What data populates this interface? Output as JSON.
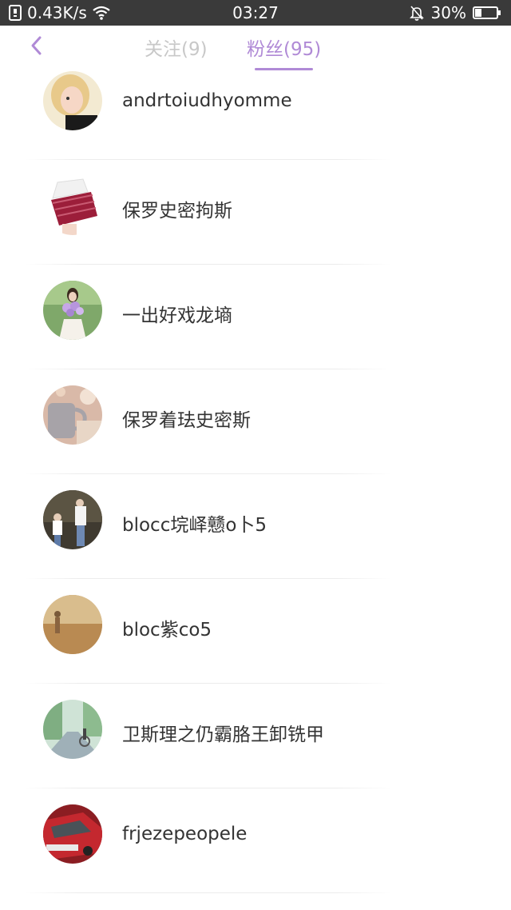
{
  "status_bar": {
    "network_speed": "0.43K/s",
    "time": "03:27",
    "battery_percent": "30%",
    "icons": [
      "sim-icon",
      "wifi-icon",
      "bell-mute-icon",
      "battery-icon"
    ]
  },
  "header": {
    "back_icon": "chevron-left-icon",
    "tabs": [
      {
        "label": "关注(9)",
        "active": false
      },
      {
        "label": "粉丝(95)",
        "active": true
      }
    ],
    "accent_color": "#b08ad6"
  },
  "fans": [
    {
      "name": "andrtoiudhyomme",
      "avatar": "avatar-photo"
    },
    {
      "name": "保罗史密拘斯",
      "avatar": "avatar-photo"
    },
    {
      "name": "一出好戏龙墒",
      "avatar": "avatar-photo"
    },
    {
      "name": "保罗着珐史密斯",
      "avatar": "avatar-photo"
    },
    {
      "name": "blocc垸峄戆o卜5",
      "avatar": "avatar-photo"
    },
    {
      "name": "bloc紫co5",
      "avatar": "avatar-photo"
    },
    {
      "name": "卫斯理之仍霸胳王卸铣甲",
      "avatar": "avatar-photo"
    },
    {
      "name": "frjezepeopele",
      "avatar": "avatar-photo"
    }
  ]
}
